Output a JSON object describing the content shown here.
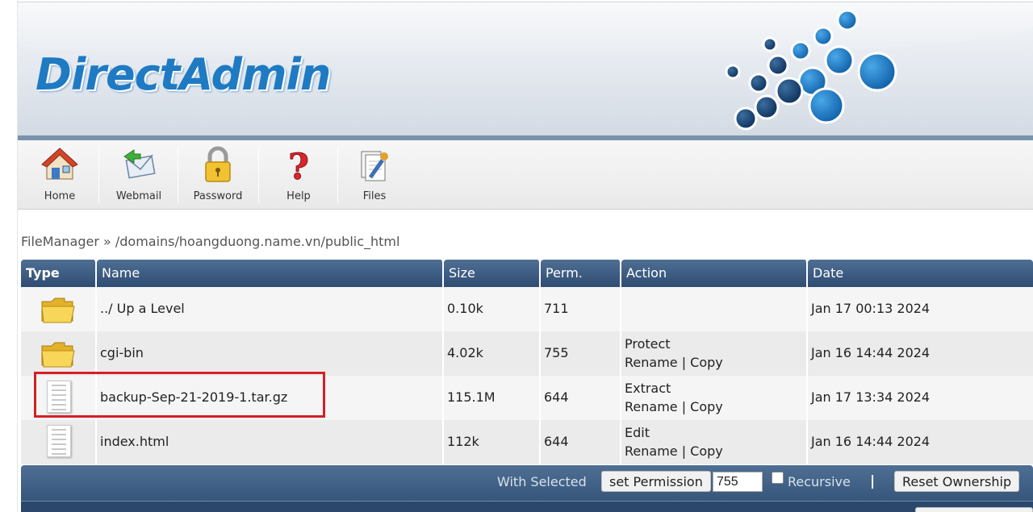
{
  "app": {
    "logo_text": "DirectAdmin"
  },
  "toolbar": {
    "items": [
      {
        "label": "Home",
        "icon": "home-icon"
      },
      {
        "label": "Webmail",
        "icon": "webmail-icon"
      },
      {
        "label": "Password",
        "icon": "lock-icon"
      },
      {
        "label": "Help",
        "icon": "help-icon"
      },
      {
        "label": "Files",
        "icon": "files-icon"
      }
    ]
  },
  "breadcrumb": "FileManager » /domains/hoangduong.name.vn/public_html",
  "table": {
    "headers": {
      "type": "Type",
      "name": "Name",
      "size": "Size",
      "perm": "Perm.",
      "action": "Action",
      "date": "Date"
    },
    "rows": [
      {
        "icon": "folder-icon",
        "name": "../ Up a Level",
        "size": "0.10k",
        "perm": "711",
        "action1": "",
        "action2": "",
        "date": "Jan 17 00:13 2024"
      },
      {
        "icon": "folder-icon",
        "name": "cgi-bin",
        "size": "4.02k",
        "perm": "755",
        "action1": "Protect",
        "action2": "Rename | Copy",
        "date": "Jan 16 14:44 2024"
      },
      {
        "icon": "file-icon",
        "name": "backup-Sep-21-2019-1.tar.gz",
        "size": "115.1M",
        "perm": "644",
        "action1": "Extract",
        "action2": "Rename | Copy",
        "date": "Jan 17 13:34 2024"
      },
      {
        "icon": "file-icon",
        "name": "index.html",
        "size": "112k",
        "perm": "644",
        "action1": "Edit",
        "action2": "Rename | Copy",
        "date": "Jan 16 14:44 2024"
      }
    ]
  },
  "footer": {
    "with_selected": "With Selected",
    "set_permission": "set Permission",
    "permission_value": "755",
    "recursive": "Recursive",
    "separator": "|",
    "reset_ownership": "Reset Ownership"
  },
  "colors": {
    "header_blue": "#3d5c82",
    "logo_blue": "#1f7ac4",
    "highlight_red": "#d32027"
  }
}
